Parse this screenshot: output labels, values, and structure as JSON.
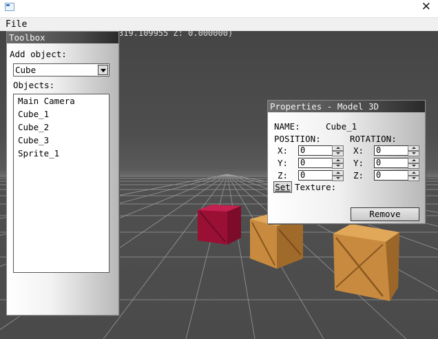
{
  "window": {
    "close_glyph": "✕"
  },
  "menu": {
    "file_label": "File"
  },
  "viewport": {
    "coords_text": "319.109955 Z: 0.000000)"
  },
  "toolbox": {
    "title": "Toolbox",
    "add_object_label": "Add object:",
    "add_object_selected": "Cube",
    "objects_label": "Objects:",
    "objects": [
      "Main Camera",
      "Cube_1",
      "Cube_2",
      "Cube_3",
      "Sprite_1"
    ]
  },
  "properties": {
    "title": "Properties - Model 3D",
    "name_label": "NAME:",
    "name_value": "Cube_1",
    "position_label": "POSITION:",
    "rotation_label": "ROTATION:",
    "x_label": "X:",
    "y_label": "Y:",
    "z_label": "Z:",
    "position": {
      "x": "0",
      "y": "0",
      "z": "0"
    },
    "rotation": {
      "x": "0",
      "y": "0",
      "z": "0"
    },
    "set_button": "Set",
    "texture_label": "Texture:",
    "remove_button": "Remove"
  },
  "colors": {
    "red_cube": "#a8123a",
    "wood_cube": "#c8893c"
  }
}
